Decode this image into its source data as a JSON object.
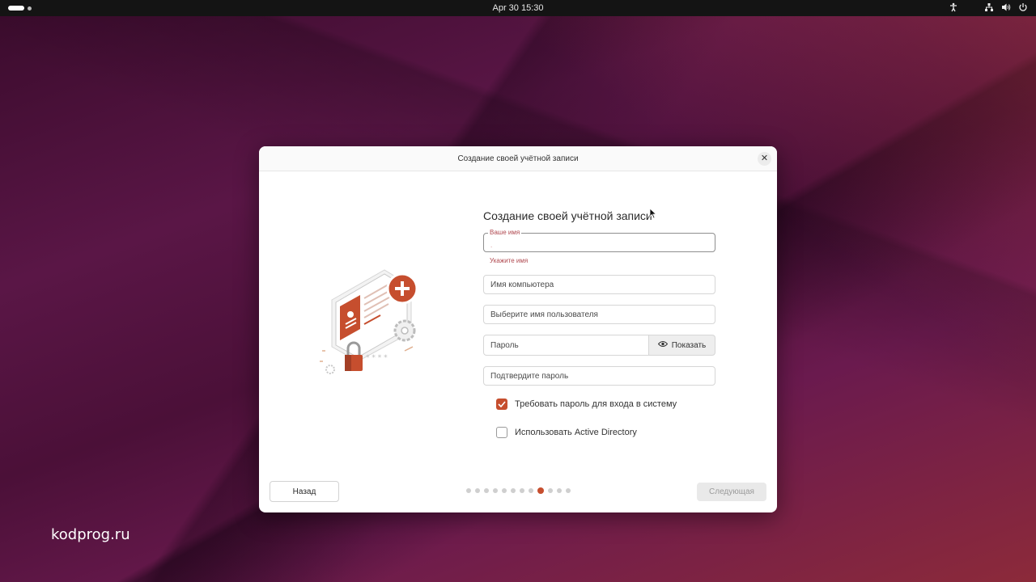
{
  "topbar": {
    "clock": "Apr 30  15:30",
    "tray_icons": [
      "accessibility-icon",
      "network-icon",
      "volume-icon",
      "power-icon"
    ]
  },
  "dialog": {
    "window_title": "Создание своей учётной записи",
    "heading": "Создание своей учётной записи",
    "name_field": {
      "label": "Ваше имя",
      "value": "",
      "error": "Укажите имя"
    },
    "computer_field": {
      "placeholder": "Имя компьютера"
    },
    "username_field": {
      "placeholder": "Выберите имя пользователя"
    },
    "password_field": {
      "placeholder": "Пароль",
      "show_label": "Показать"
    },
    "confirm_field": {
      "placeholder": "Подтвердите пароль"
    },
    "require_password": {
      "label": "Требовать пароль для входа в систему",
      "checked": true
    },
    "active_directory": {
      "label": "Использовать Active Directory",
      "checked": false
    },
    "back_label": "Назад",
    "next_label": "Следующая",
    "steps": {
      "total": 12,
      "current": 9
    },
    "accent": "#c64e2e"
  },
  "watermark": "kodprog.ru"
}
